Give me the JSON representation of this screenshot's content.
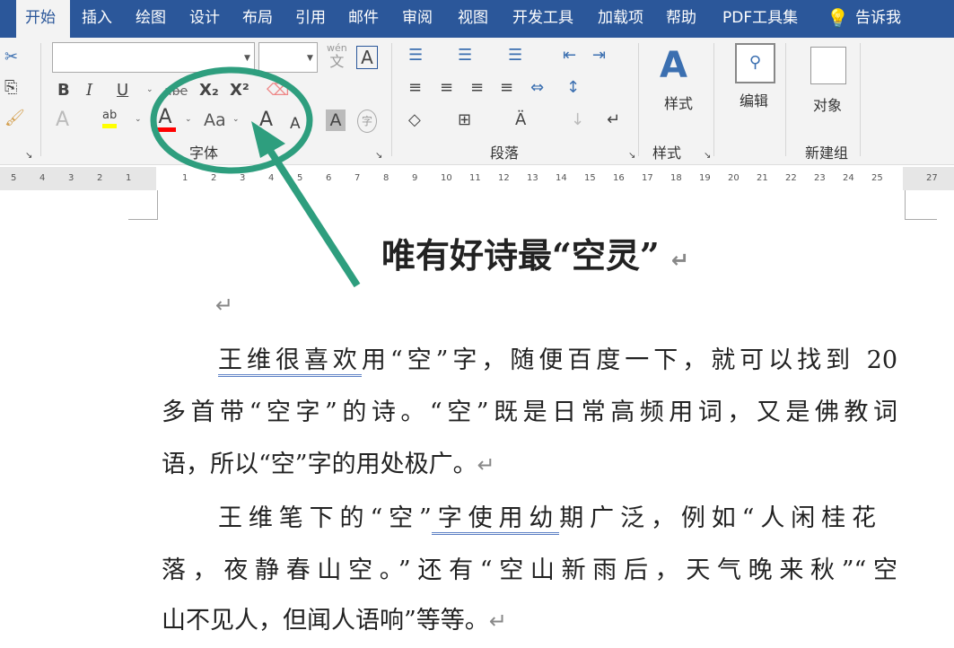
{
  "tabs": [
    "开始",
    "插入",
    "绘图",
    "设计",
    "布局",
    "引用",
    "邮件",
    "审阅",
    "视图",
    "开发工具",
    "加载项",
    "帮助",
    "PDF工具集",
    "告诉我"
  ],
  "ribbon": {
    "font_group": "字体",
    "paragraph_group": "段落",
    "styles_group": "样式",
    "new_group": "新建组",
    "styles_button": "样式",
    "edit_button": "编辑",
    "object_button": "对象",
    "font_name": "",
    "font_size": "",
    "phonetic": "wén",
    "phonetic_char": "文",
    "bold": "B",
    "italic": "I",
    "underline": "U",
    "strike": "abe",
    "subscript": "X₂",
    "superscript": "X²",
    "change_case": "Aa",
    "grow": "A",
    "shrink": "A",
    "highlight_label": "ab",
    "font_color_label": "A",
    "text_effects": "A",
    "char_shading": "A",
    "enclose": "字"
  },
  "colors": {
    "accent": "#2b579a",
    "highlight": "#ffff00",
    "font_color": "#ff0000",
    "annotation": "#2e9e7e"
  },
  "ruler": {
    "left": [
      "5",
      "4",
      "3",
      "2",
      "1"
    ],
    "right": [
      "1",
      "2",
      "3",
      "4",
      "5",
      "6",
      "7",
      "8",
      "9",
      "10",
      "11",
      "12",
      "13",
      "14",
      "15",
      "16",
      "17",
      "18",
      "19",
      "20",
      "21",
      "22",
      "23",
      "24",
      "25",
      "27"
    ]
  },
  "document": {
    "title": "唯有好诗最“空灵”",
    "p1": [
      "王维很喜欢",
      "用“空”字，随便百度一下，就可以找到 20",
      "多首带“空字”的诗。“空”既是日常高频用词，又是佛教词",
      "语，所以“空”字的用处极广。"
    ],
    "p2": [
      "王维笔下的“空”",
      "字使用幼",
      "期广泛，例如“人闲桂花",
      "落，夜静春山空。”还有“空山新雨后，天气晚来秋”“空",
      "山不见人，但闻人语响”等等。"
    ],
    "return_mark": "↵"
  }
}
